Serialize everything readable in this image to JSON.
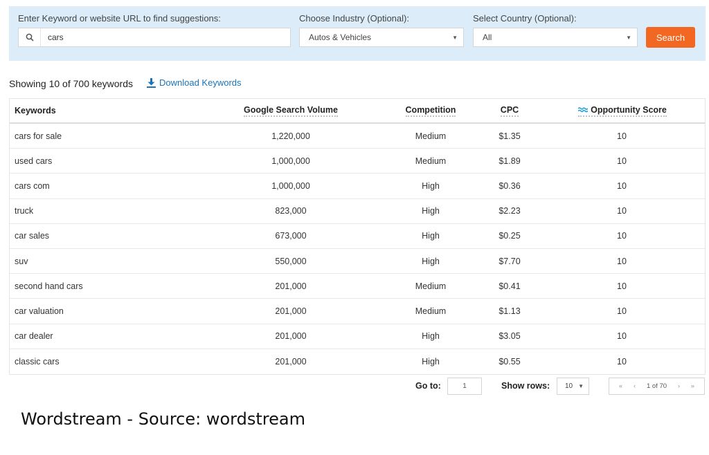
{
  "search": {
    "keyword_label": "Enter Keyword or website URL to find suggestions:",
    "keyword_value": "cars",
    "industry_label": "Choose Industry (Optional):",
    "industry_value": "Autos & Vehicles",
    "country_label": "Select Country (Optional):",
    "country_value": "All",
    "search_button": "Search",
    "accent_color": "#f26722",
    "panel_color": "#dcedf9"
  },
  "summary": {
    "showing_text": "Showing 10 of 700 keywords",
    "download_label": "Download Keywords",
    "link_color": "#1a73b8"
  },
  "table": {
    "headers": {
      "keywords": "Keywords",
      "volume": "Google Search Volume",
      "competition": "Competition",
      "cpc": "CPC",
      "opportunity": "Opportunity Score"
    },
    "rows": [
      {
        "keyword": "cars for sale",
        "volume": "1,220,000",
        "competition": "Medium",
        "cpc": "$1.35",
        "score": "10"
      },
      {
        "keyword": "used cars",
        "volume": "1,000,000",
        "competition": "Medium",
        "cpc": "$1.89",
        "score": "10"
      },
      {
        "keyword": "cars com",
        "volume": "1,000,000",
        "competition": "High",
        "cpc": "$0.36",
        "score": "10"
      },
      {
        "keyword": "truck",
        "volume": "823,000",
        "competition": "High",
        "cpc": "$2.23",
        "score": "10"
      },
      {
        "keyword": "car sales",
        "volume": "673,000",
        "competition": "High",
        "cpc": "$0.25",
        "score": "10"
      },
      {
        "keyword": "suv",
        "volume": "550,000",
        "competition": "High",
        "cpc": "$7.70",
        "score": "10"
      },
      {
        "keyword": "second hand cars",
        "volume": "201,000",
        "competition": "Medium",
        "cpc": "$0.41",
        "score": "10"
      },
      {
        "keyword": "car valuation",
        "volume": "201,000",
        "competition": "Medium",
        "cpc": "$1.13",
        "score": "10"
      },
      {
        "keyword": "car dealer",
        "volume": "201,000",
        "competition": "High",
        "cpc": "$3.05",
        "score": "10"
      },
      {
        "keyword": "classic cars",
        "volume": "201,000",
        "competition": "High",
        "cpc": "$0.55",
        "score": "10"
      }
    ]
  },
  "pagination": {
    "goto_label": "Go to:",
    "goto_value": "1",
    "rows_label": "Show rows:",
    "rows_value": "10",
    "first": "«",
    "prev": "‹",
    "page_info": "1 of 70",
    "next": "›",
    "last": "»"
  },
  "caption": "Wordstream - Source: wordstream"
}
